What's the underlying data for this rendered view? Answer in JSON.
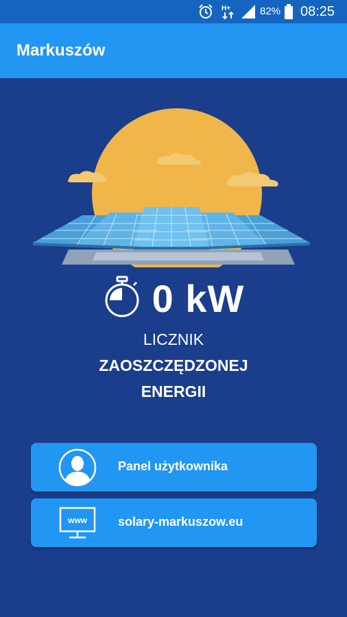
{
  "status_bar": {
    "battery_percent": "82%",
    "time": "08:25",
    "network": "H+",
    "icons": [
      "alarm-icon",
      "data-arrows-icon",
      "signal-icon",
      "battery-icon"
    ]
  },
  "app_bar": {
    "title": "Markuszów"
  },
  "hero": {
    "image": "sun-solar-panels-illustration"
  },
  "counter": {
    "value": "0 kW",
    "icon": "stopwatch-icon",
    "label_line1": "LICZNIK",
    "label_line2": "ZAOSZCZĘDZONEJ",
    "label_line3": "ENERGII"
  },
  "buttons": [
    {
      "label": "Panel użytkownika",
      "icon": "user-avatar-icon"
    },
    {
      "label": "solary-markuszow.eu",
      "icon": "www-monitor-icon"
    }
  ],
  "colors": {
    "background": "#1a3e8c",
    "app_bar": "#2196f3",
    "status_bar": "#1565c0",
    "button": "#2196f3",
    "sun": "#f0b64a"
  }
}
